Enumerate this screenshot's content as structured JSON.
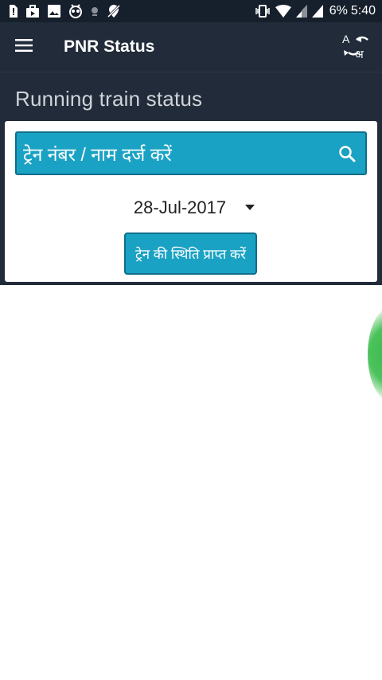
{
  "status_bar": {
    "battery_percent": "6%",
    "time": "5:40",
    "left_icons": [
      "sim-alert-icon",
      "briefcase-icon",
      "image-icon",
      "owl-icon",
      "dot-icon",
      "no-location-icon"
    ],
    "right_icons": [
      "vibrate-icon",
      "wifi-icon",
      "signal-icon",
      "signal-icon"
    ]
  },
  "app_bar": {
    "title": "PNR Status",
    "menu_icon": "hamburger-menu-icon",
    "language_icon": "translate-icon",
    "language_from": "A",
    "language_to": "अ"
  },
  "page": {
    "section_title": "Running train status",
    "search_placeholder": "ट्रेन नंबर / नाम दर्ज करें",
    "date": "28-Jul-2017",
    "get_status_button": "ट्रेन की स्थिति प्राप्त करें"
  },
  "colors": {
    "status_bar_bg": "#16202c",
    "app_bar_bg": "#222b39",
    "accent": "#1aa2c4",
    "accent_border": "#0f6f89",
    "fab": "#34b34a"
  }
}
